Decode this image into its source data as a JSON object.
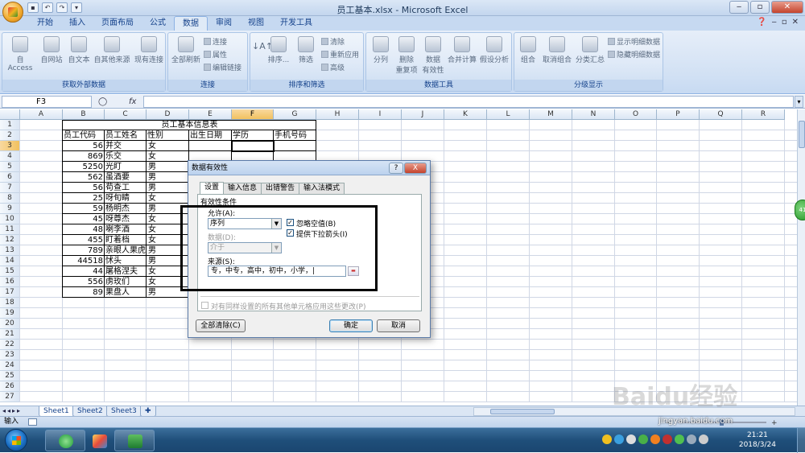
{
  "window": {
    "title": "员工基本.xlsx - Microsoft Excel"
  },
  "tabs": [
    "开始",
    "插入",
    "页面布局",
    "公式",
    "数据",
    "审阅",
    "视图",
    "开发工具"
  ],
  "active_tab": "数据",
  "ribbon": {
    "groups": {
      "external": {
        "label": "获取外部数据",
        "buttons": [
          "自 Access",
          "自网站",
          "自文本",
          "自其他来源",
          "现有连接"
        ]
      },
      "connections": {
        "label": "连接",
        "big": "全部刷新",
        "small": [
          "连接",
          "属性",
          "编辑链接"
        ]
      },
      "sort": {
        "label": "排序和筛选",
        "buttons": [
          "排序...",
          "筛选"
        ],
        "small": [
          "清除",
          "重新应用",
          "高级"
        ]
      },
      "tools": {
        "label": "数据工具",
        "buttons": [
          "分列",
          "删除\n重复项",
          "数据\n有效性",
          "合并计算",
          "假设分析"
        ]
      },
      "outline": {
        "label": "分级显示",
        "buttons": [
          "组合",
          "取消组合",
          "分类汇总"
        ],
        "small": [
          "显示明细数据",
          "隐藏明细数据"
        ]
      }
    }
  },
  "formula_bar": {
    "name_box": "F3",
    "fx": "fx",
    "formula": ""
  },
  "columns": [
    "A",
    "B",
    "C",
    "D",
    "E",
    "F",
    "G",
    "H",
    "I",
    "J",
    "K",
    "L",
    "M",
    "N",
    "O",
    "P",
    "Q",
    "R"
  ],
  "selected_column": "F",
  "selected_row": 3,
  "rows": [
    "1",
    "2",
    "3",
    "4",
    "5",
    "6",
    "7",
    "8",
    "9",
    "10",
    "11",
    "12",
    "13",
    "14",
    "15",
    "16",
    "17",
    "18",
    "19",
    "20",
    "21",
    "22",
    "23",
    "24",
    "25",
    "26",
    "27"
  ],
  "table": {
    "title": "员工基本信息表",
    "headers": [
      "员工代码",
      "员工姓名",
      "性别",
      "出生日期",
      "学历",
      "手机号码"
    ],
    "records": [
      {
        "code": "56",
        "name": "并交",
        "gender": "女"
      },
      {
        "code": "869",
        "name": "乐交",
        "gender": "女"
      },
      {
        "code": "5250",
        "name": "光盯",
        "gender": "男"
      },
      {
        "code": "562",
        "name": "虽酒要",
        "gender": "男"
      },
      {
        "code": "56",
        "name": "苟查工",
        "gender": "男"
      },
      {
        "code": "25",
        "name": "呀旬睛",
        "gender": "女"
      },
      {
        "code": "59",
        "name": "杨明杰",
        "gender": "男"
      },
      {
        "code": "45",
        "name": "呀尊杰",
        "gender": "女"
      },
      {
        "code": "48",
        "name": "喇李酒",
        "gender": "女"
      },
      {
        "code": "455",
        "name": "盯着档",
        "gender": "女"
      },
      {
        "code": "789",
        "name": "亲眼人果虎",
        "gender": "男"
      },
      {
        "code": "44518",
        "name": "怵头",
        "gender": "男"
      },
      {
        "code": "44",
        "name": "屠格涅夫",
        "gender": "女"
      },
      {
        "code": "556",
        "name": "虏玫们",
        "gender": "女"
      },
      {
        "code": "89",
        "name": "果盘人",
        "gender": "男"
      }
    ]
  },
  "sheets": [
    "Sheet1",
    "Sheet2",
    "Sheet3"
  ],
  "active_sheet": "Sheet1",
  "status": {
    "mode": "输入"
  },
  "dialog": {
    "title": "数据有效性",
    "help": "?",
    "close": "X",
    "tabs": [
      "设置",
      "输入信息",
      "出错警告",
      "输入法模式"
    ],
    "section_label": "有效性条件",
    "allow_label": "允许(A):",
    "allow_value": "序列",
    "ignore_blank": "忽略空值(B)",
    "dropdown_arrow": "提供下拉箭头(I)",
    "data_label": "数据(D):",
    "data_value": "介于",
    "source_label": "来源(S):",
    "source_value": "专，中专，高中，初中，小学，|",
    "apply_all": "对有同样设置的所有其他单元格应用这些更改(P)",
    "clear_all": "全部清除(C)",
    "ok": "确定",
    "cancel": "取消"
  },
  "taskbar": {
    "time": "21:21",
    "date": "2018/3/24"
  },
  "watermark": {
    "brand": "Baidu经验",
    "url": "jingyan.baidu.com"
  },
  "colors": {
    "accent": "#15428b",
    "ribbon": "#dfeaf7",
    "selected_header": "#f1c15f",
    "start_orb": "#1a6fc4",
    "taskbar": "#1f4f7a"
  }
}
